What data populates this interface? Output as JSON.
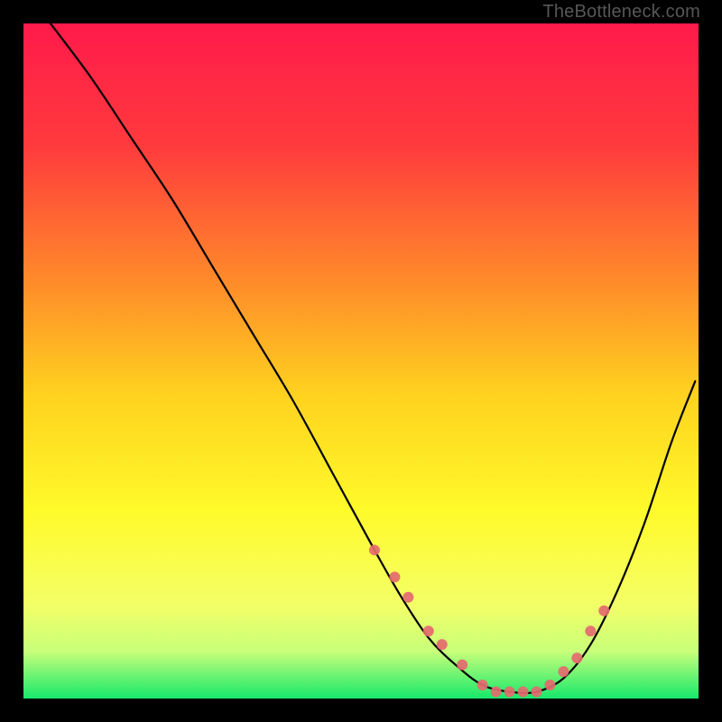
{
  "watermark": "TheBottleneck.com",
  "chart_data": {
    "type": "line",
    "title": "",
    "xlabel": "",
    "ylabel": "",
    "xlim": [
      0,
      100
    ],
    "ylim": [
      0,
      100
    ],
    "grid": false,
    "gradient_stops": [
      {
        "offset": 0.0,
        "color": "#ff1a4b"
      },
      {
        "offset": 0.18,
        "color": "#ff3a3d"
      },
      {
        "offset": 0.38,
        "color": "#ff8a2a"
      },
      {
        "offset": 0.55,
        "color": "#ffd21f"
      },
      {
        "offset": 0.72,
        "color": "#fffa2a"
      },
      {
        "offset": 0.86,
        "color": "#f4ff66"
      },
      {
        "offset": 0.93,
        "color": "#c8ff7a"
      },
      {
        "offset": 1.0,
        "color": "#17e86b"
      }
    ],
    "series": [
      {
        "name": "bottleneck-curve",
        "color": "#000000",
        "x": [
          4,
          10,
          16,
          22,
          28,
          34,
          40,
          46,
          52,
          56,
          60,
          64,
          68,
          72,
          76,
          80,
          84,
          88,
          92,
          96,
          99.5
        ],
        "values": [
          100,
          92,
          83,
          74,
          64,
          54,
          44,
          33,
          22,
          15,
          9,
          5,
          2,
          1,
          1,
          3,
          8,
          16,
          26,
          38,
          47
        ]
      }
    ],
    "markers": {
      "name": "measured-points",
      "color": "#e46a6f",
      "radius": 6,
      "x": [
        52,
        55,
        57,
        60,
        62,
        65,
        68,
        70,
        72,
        74,
        76,
        78,
        80,
        82,
        84,
        86
      ],
      "values": [
        22,
        18,
        15,
        10,
        8,
        5,
        2,
        1,
        1,
        1,
        1,
        2,
        4,
        6,
        10,
        13
      ]
    }
  }
}
